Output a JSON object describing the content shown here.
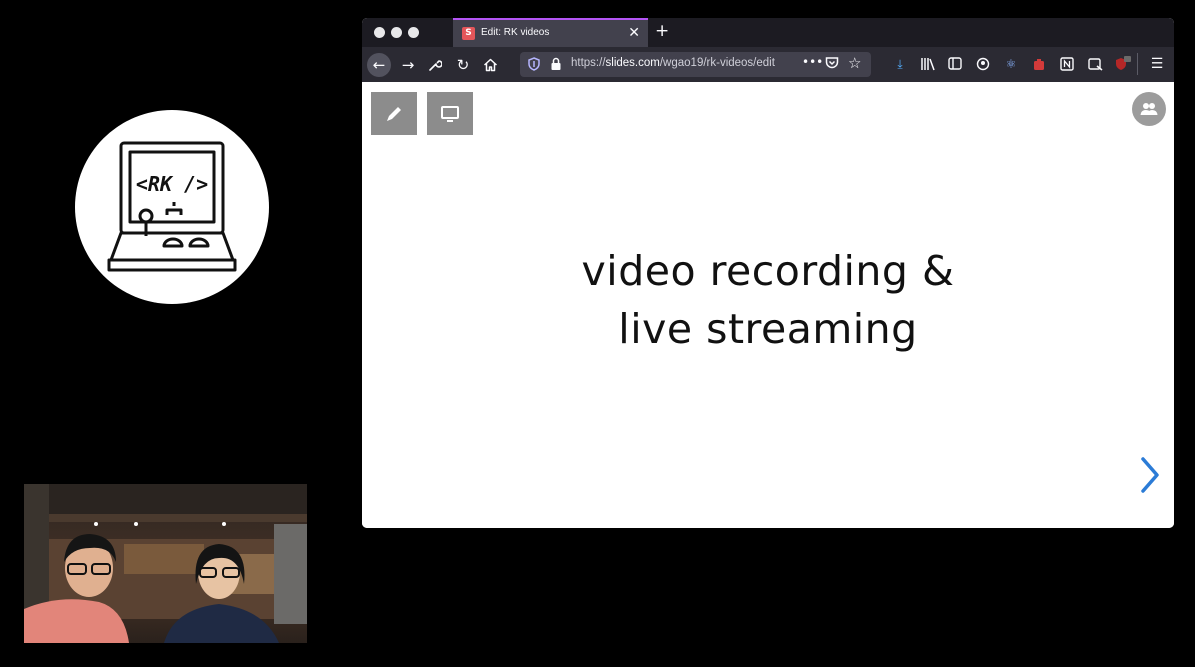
{
  "logo": {
    "text": "<RK />"
  },
  "browser": {
    "tab": {
      "favicon": "S",
      "title": "Edit: RK videos",
      "close": "✕"
    },
    "new_tab": "+",
    "url": {
      "prefix": "https://",
      "host": "slides.com",
      "path": "/wgao19/rk-videos/edit",
      "more": "•••"
    },
    "toolbar_icons": [
      "download-icon",
      "library-icon",
      "sidebar-icon",
      "account-icon",
      "react-devtools-icon",
      "extension-icon",
      "notion-icon",
      "screenshot-icon",
      "ublock-icon",
      "menu-icon"
    ]
  },
  "slide": {
    "line1": "video recording &",
    "line2": "live streaming"
  },
  "colors": {
    "tab_accent": "#b455f5",
    "slides_brand": "#e4565a",
    "download_blue": "#54ffbd",
    "next_arrow": "#2b7bd6"
  }
}
